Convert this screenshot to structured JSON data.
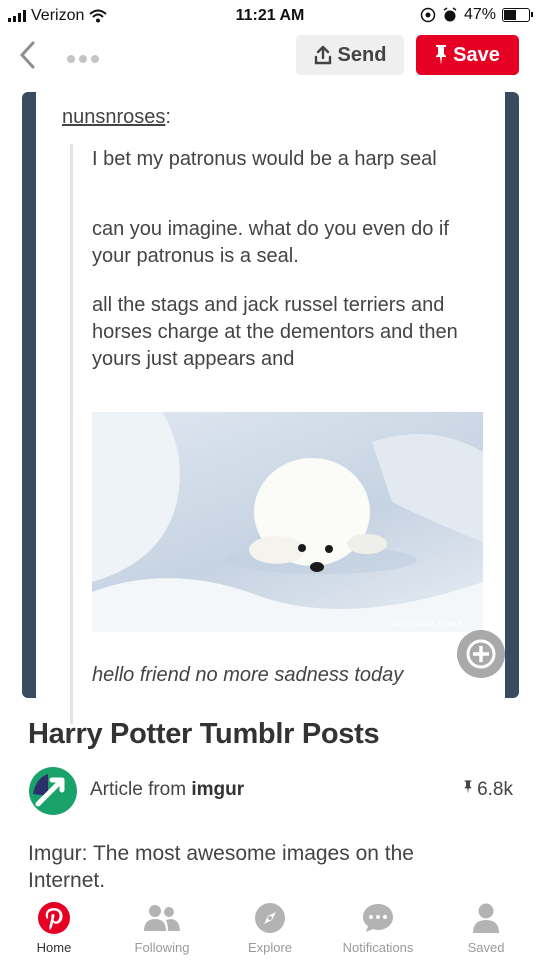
{
  "status_bar": {
    "carrier": "Verizon",
    "time": "11:21 AM",
    "battery": "47%",
    "battery_level": 0.47
  },
  "toolbar": {
    "send_label": "Send",
    "save_label": "Save"
  },
  "pin_image": {
    "username": "nunsnroses",
    "username_suffix": ":",
    "paragraphs": [
      "I bet my patronus would be a harp seal",
      "can you imagine. what do you even do if your patronus is a seal.",
      "all the stags and jack russel terriers and horses charge at the dementors and then yours just appears and"
    ],
    "caption": "hello friend no more sadness today"
  },
  "pin": {
    "title": "Harry Potter Tumblr Posts",
    "article_prefix": "Article from ",
    "article_source": "imgur",
    "saves_count": "6.8k",
    "description": "Imgur: The most awesome images on the Internet."
  },
  "tabs": [
    {
      "label": "Home",
      "icon": "pinterest-logo-icon",
      "active": true
    },
    {
      "label": "Following",
      "icon": "people-icon",
      "active": false
    },
    {
      "label": "Explore",
      "icon": "compass-icon",
      "active": false
    },
    {
      "label": "Notifications",
      "icon": "chat-bubble-icon",
      "active": false
    },
    {
      "label": "Saved",
      "icon": "person-icon",
      "active": false
    }
  ],
  "colors": {
    "brand_red": "#e60023",
    "tumblr_frame": "#384b61"
  }
}
